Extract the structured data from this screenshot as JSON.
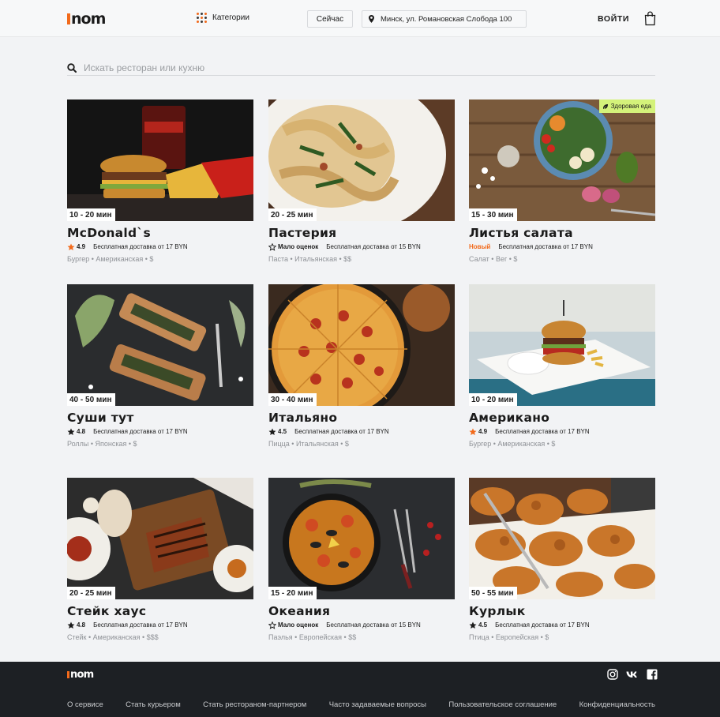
{
  "header": {
    "logo": "nom",
    "categories_label": "Категории",
    "now_label": "Сейчас",
    "address": "Минск, ул. Романовская Слобода 100",
    "login_label": "ВОЙТИ"
  },
  "search": {
    "placeholder": "Искать ресторан или кухню"
  },
  "restaurants": [
    {
      "name": "McDonald`s",
      "time": "10 - 20 мин",
      "rating": "4.9",
      "star": "filled-orange",
      "delivery": "Бесплатная доставка от 17 BYN",
      "cuisine": "Бургер • Американская • $"
    },
    {
      "name": "Пастерия",
      "time": "20 - 25 мин",
      "rating": "Мало оценок",
      "star": "outline",
      "delivery": "Бесплатная доставка от 15 BYN",
      "cuisine": "Паста • Итальянская • $$"
    },
    {
      "name": "Листья салата",
      "time": "15 - 30 мин",
      "badge": "Новый",
      "tag": "Здоровая еда",
      "delivery": "Бесплатная доставка от 17 BYN",
      "cuisine": "Салат • Вег • $"
    },
    {
      "name": "Суши тут",
      "time": "40 - 50 мин",
      "rating": "4.8",
      "star": "filled-black",
      "delivery": "Бесплатная доставка от 17 BYN",
      "cuisine": "Роллы • Японская • $"
    },
    {
      "name": "Итальяно",
      "time": "30 - 40 мин",
      "rating": "4.5",
      "star": "filled-black",
      "delivery": "Бесплатная доставка от 17 BYN",
      "cuisine": "Пицца • Итальянская • $"
    },
    {
      "name": "Американо",
      "time": "10 - 20 мин",
      "rating": "4.9",
      "star": "filled-orange",
      "delivery": "Бесплатная доставка от 17 BYN",
      "cuisine": "Бургер • Американская • $"
    },
    {
      "name": "Стейк хаус",
      "time": "20 - 25 мин",
      "rating": "4.8",
      "star": "filled-black",
      "delivery": "Бесплатная доставка от 17 BYN",
      "cuisine": "Стейк • Американская • $$$"
    },
    {
      "name": "Океания",
      "time": "15 - 20 мин",
      "rating": "Мало оценок",
      "star": "outline",
      "delivery": "Бесплатная доставка от 15 BYN",
      "cuisine": "Паэлья • Европейская • $$"
    },
    {
      "name": "Курлык",
      "time": "50 - 55 мин",
      "rating": "4.5",
      "star": "filled-black",
      "delivery": "Бесплатная доставка от 17 BYN",
      "cuisine": "Птица • Европейская • $"
    }
  ],
  "footer": {
    "logo": "nom",
    "links": [
      "О сервисе",
      "Стать курьером",
      "Стать рестораном-партнером",
      "Часто задаваемые вопросы",
      "Пользовательское соглашение",
      "Конфиденциальность"
    ],
    "socials": [
      "instagram-icon",
      "vk-icon",
      "facebook-icon"
    ]
  },
  "colors": {
    "accent": "#f26a1b",
    "healthy_tag": "#d4f27a",
    "footer_bg": "#1d2024",
    "page_bg": "#f2f3f5"
  }
}
